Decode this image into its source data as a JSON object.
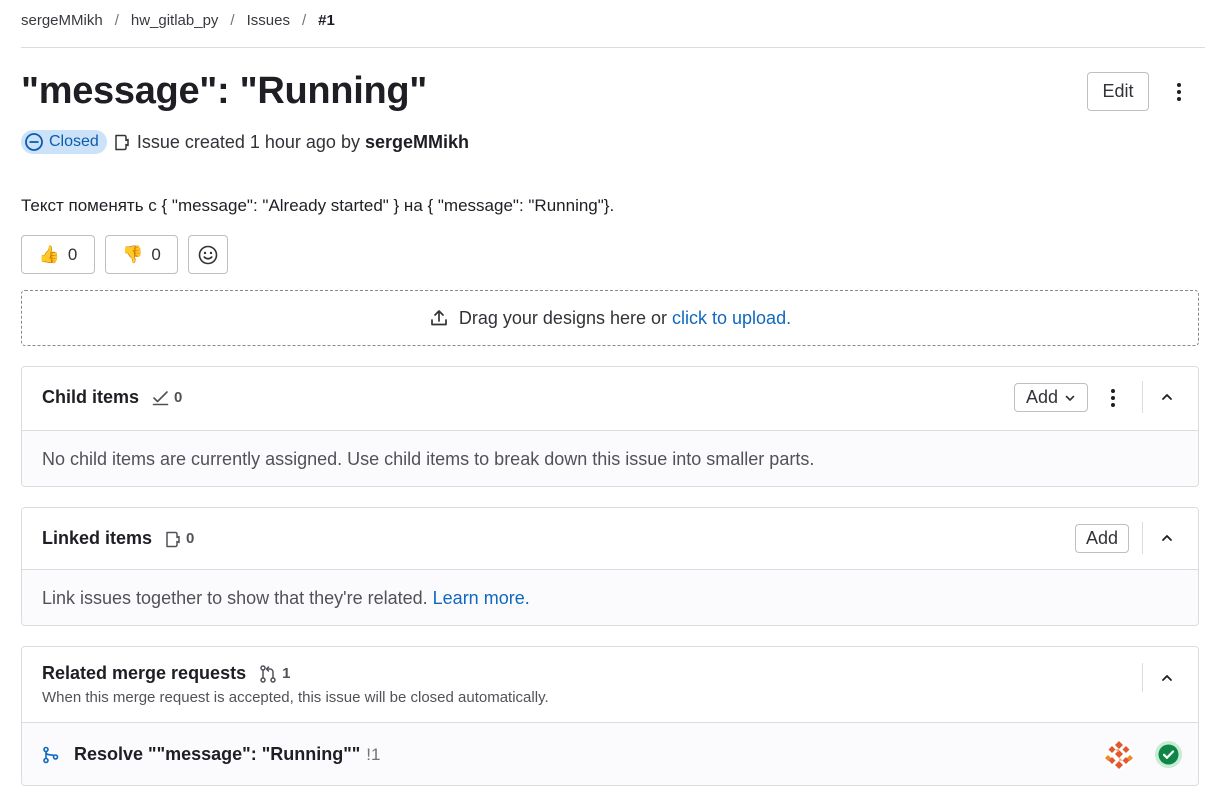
{
  "breadcrumb": {
    "items": [
      "sergeMMikh",
      "hw_gitlab_py",
      "Issues"
    ],
    "current": "#1",
    "separator": "/"
  },
  "issue": {
    "title": "\"message\": \"Running\"",
    "status": "Closed",
    "created_text": "Issue created 1 hour ago by",
    "author": "sergeMMikh",
    "description": "Текст поменять с { \"message\": \"Already started\" } на { \"message\": \"Running\"}."
  },
  "header": {
    "edit_label": "Edit"
  },
  "reactions": {
    "thumbs_up_count": "0",
    "thumbs_down_count": "0",
    "thumbs_up_glyph": "👍",
    "thumbs_down_glyph": "👎"
  },
  "dropzone": {
    "text": "Drag your designs here or",
    "link": "click to upload."
  },
  "child_items": {
    "title": "Child items",
    "count": "0",
    "add_label": "Add",
    "empty_text": "No child items are currently assigned. Use child items to break down this issue into smaller parts."
  },
  "linked_items": {
    "title": "Linked items",
    "count": "0",
    "add_label": "Add",
    "empty_text": "Link issues together to show that they're related.",
    "learn_more": "Learn more."
  },
  "related_mrs": {
    "title": "Related merge requests",
    "count": "1",
    "subtitle": "When this merge request is accepted, this issue will be closed automatically.",
    "items": [
      {
        "title": "Resolve \"\"message\": \"Running\"\"",
        "ref": "!1"
      }
    ]
  },
  "colors": {
    "link": "#1068bf",
    "closed_badge_bg": "#cbe2f9",
    "closed_badge_text": "#0b5cad",
    "success": "#108548"
  }
}
